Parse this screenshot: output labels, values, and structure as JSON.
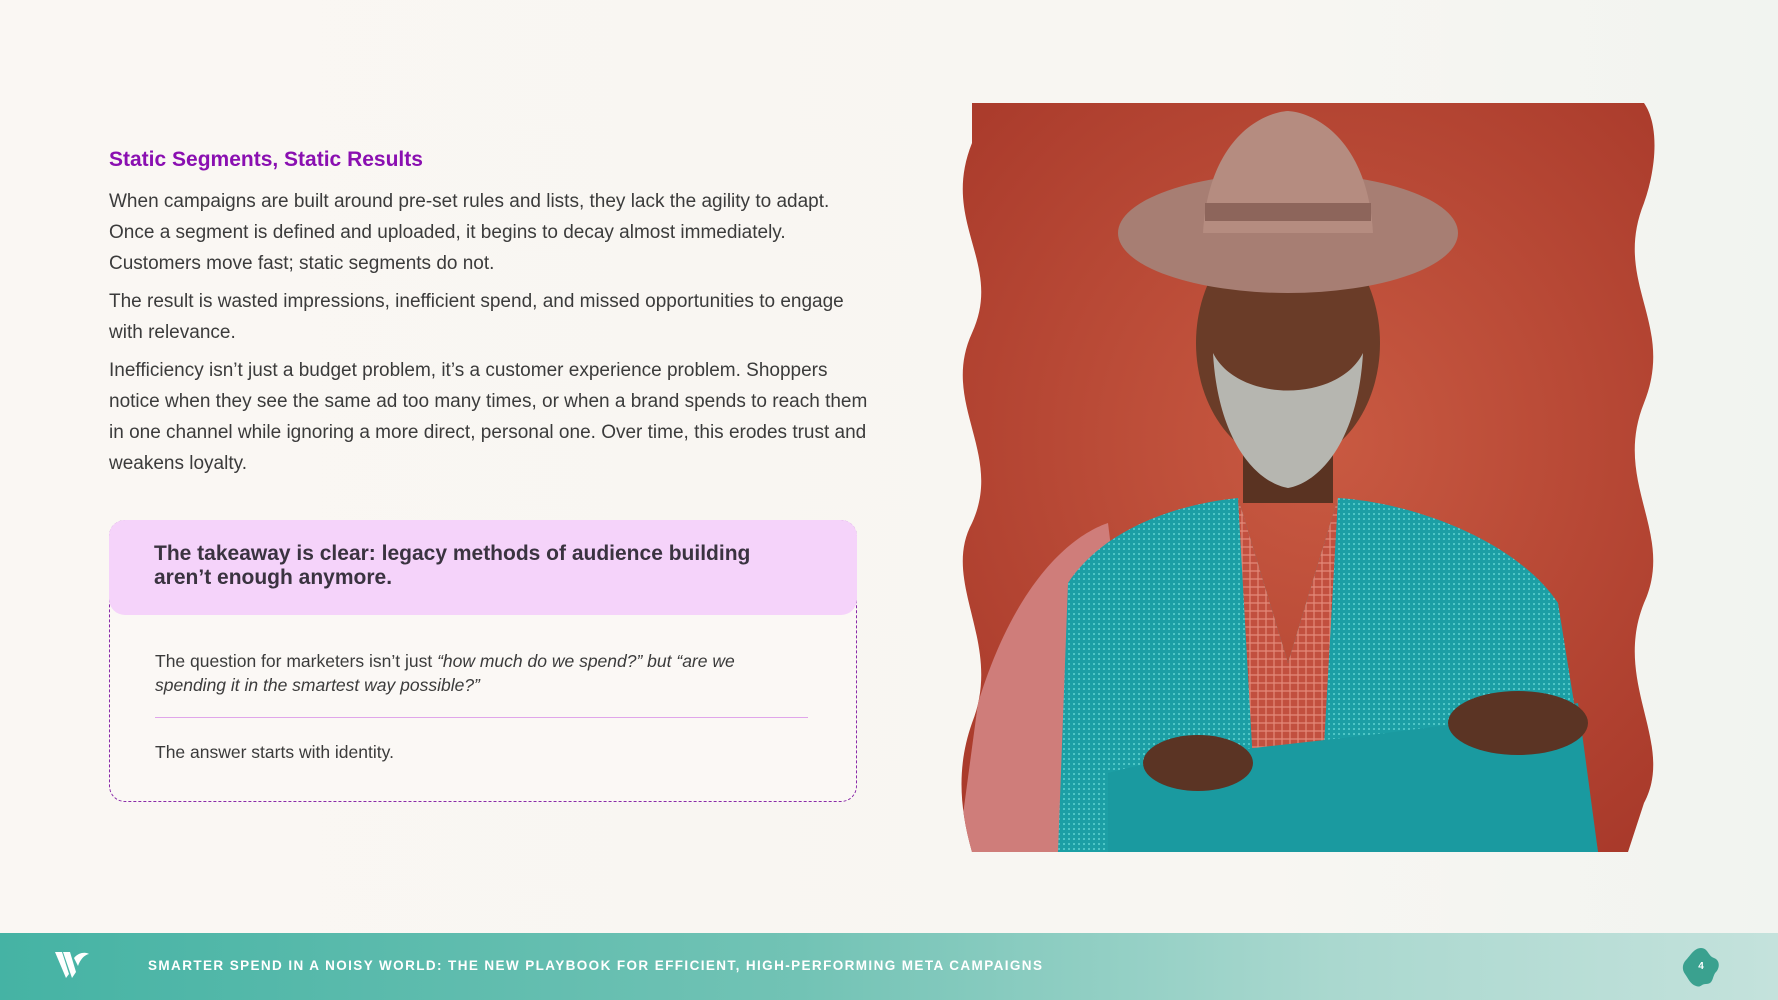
{
  "section": {
    "title": "Static Segments, Static Results",
    "paragraphs": [
      "When campaigns are built around pre-set rules and lists, they lack the agility to adapt. Once a  segment is defined and uploaded, it begins to decay almost immediately. Customers move fast; static segments do not.",
      "The result is wasted impressions, inefficient spend, and missed opportunities to engage with relevance.",
      "Inefficiency isn’t just a budget problem, it’s a customer experience problem. Shoppers notice when they see the same ad too many times, or when a brand spends to reach them in one  channel while ignoring a more direct, personal one. Over time, this erodes trust and weakens  loyalty."
    ]
  },
  "callout": {
    "headline": "The takeaway is clear: legacy methods of audience building aren’t enough anymore.",
    "question_lead": "The question for marketers isn’t just ",
    "question_italic": "“how much do we spend?” but “are we spending it in the smartest way possible?”",
    "answer": "The answer starts with identity."
  },
  "footer": {
    "title": "SMARTER SPEND IN A NOISY WORLD: THE NEW PLAYBOOK FOR EFFICIENT, HIGH-PERFORMING META CAMPAIGNS",
    "page_number": "4"
  },
  "colors": {
    "accent_purple": "#8a0fb1",
    "callout_fill": "#f5d3fa",
    "footer_teal": "#45b3a4",
    "portrait_background": "#b8442f"
  },
  "icons": [
    "brand-logo-icon",
    "page-badge-icon"
  ]
}
